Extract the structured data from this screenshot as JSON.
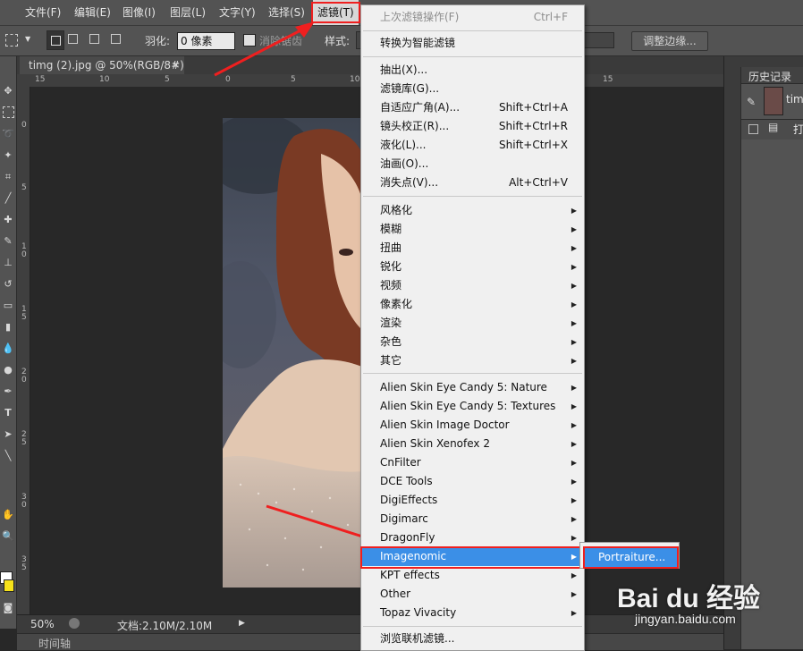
{
  "menubar": {
    "items": [
      "文件(F)",
      "编辑(E)",
      "图像(I)",
      "图层(L)",
      "文字(Y)",
      "选择(S)",
      "滤镜(T)"
    ],
    "active": "滤镜(T)"
  },
  "options": {
    "feather_label": "羽化:",
    "feather_value": "0 像素",
    "antialias_label": "消除锯齿",
    "style_label": "样式:",
    "refine_edge_button": "调整边缘..."
  },
  "document": {
    "tab_title": "timg (2).jpg @ 50%(RGB/8#)",
    "close_glyph": "×",
    "zoom": "50%",
    "doc_info": "文档:2.10M/2.10M",
    "ruler_h": [
      "15",
      "10",
      "5",
      "0",
      "5",
      "10",
      "15"
    ],
    "ruler_v": [
      "0",
      "5",
      "1 0",
      "1 5",
      "2 0",
      "2 5",
      "3 0",
      "3 5"
    ]
  },
  "timeline_label": "时间轴",
  "history_panel": {
    "title": "历史记录",
    "snapshot_label": "tim",
    "step_label": "打"
  },
  "filter_menu": {
    "last_filter": {
      "label": "上次滤镜操作(F)",
      "shortcut": "Ctrl+F"
    },
    "convert_smart": "转换为智能滤镜",
    "group1": [
      {
        "label": "抽出(X)...",
        "shortcut": ""
      },
      {
        "label": "滤镜库(G)...",
        "shortcut": ""
      },
      {
        "label": "自适应广角(A)...",
        "shortcut": "Shift+Ctrl+A"
      },
      {
        "label": "镜头校正(R)...",
        "shortcut": "Shift+Ctrl+R"
      },
      {
        "label": "液化(L)...",
        "shortcut": "Shift+Ctrl+X"
      },
      {
        "label": "油画(O)...",
        "shortcut": ""
      },
      {
        "label": "消失点(V)...",
        "shortcut": "Alt+Ctrl+V"
      }
    ],
    "group2": [
      "风格化",
      "模糊",
      "扭曲",
      "锐化",
      "视频",
      "像素化",
      "渲染",
      "杂色",
      "其它"
    ],
    "group3": [
      "Alien Skin Eye Candy 5: Nature",
      "Alien Skin Eye Candy 5: Textures",
      "Alien Skin Image Doctor",
      "Alien Skin Xenofex 2",
      "CnFilter",
      "DCE Tools",
      "DigiEffects",
      "Digimarc",
      "DragonFly",
      "Imagenomic",
      "KPT effects",
      "Other",
      "Topaz Vivacity"
    ],
    "highlighted": "Imagenomic",
    "browse_online": "浏览联机滤镜...",
    "submenu_item": "Portraiture..."
  },
  "watermark": {
    "brand": "Bai du 经验",
    "url": "jingyan.baidu.com"
  },
  "colors": {
    "accent_highlight": "#3b8fe7",
    "annotation_red": "#ef1f1f",
    "foreground_swatch": "#ffffff",
    "background_swatch": "#f6e21a"
  }
}
